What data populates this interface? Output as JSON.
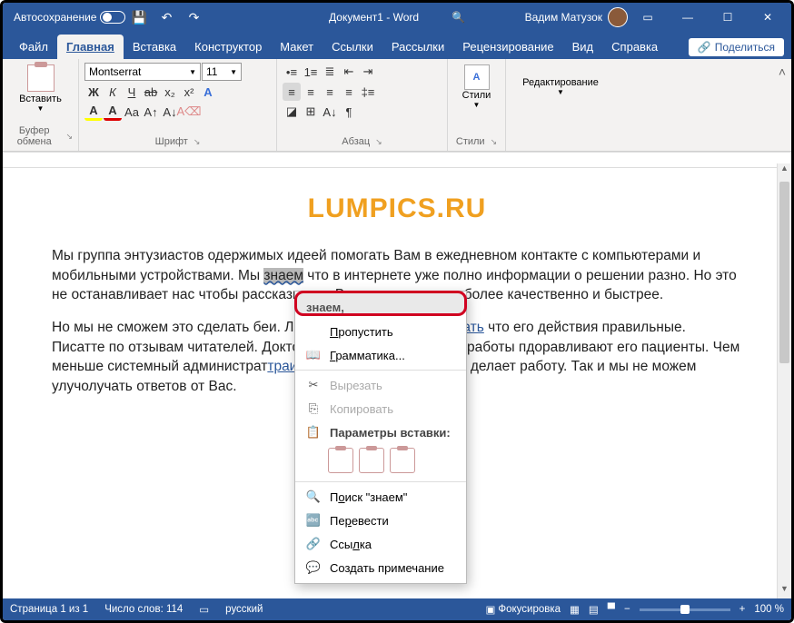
{
  "titlebar": {
    "autosave": "Автосохранение",
    "doc": "Документ1 - Word",
    "user": "Вадим Матузок"
  },
  "tabs": {
    "file": "Файл",
    "home": "Главная",
    "insert": "Вставка",
    "design": "Конструктор",
    "layout": "Макет",
    "references": "Ссылки",
    "mailings": "Рассылки",
    "review": "Рецензирование",
    "view": "Вид",
    "help": "Справка",
    "share": "Поделиться"
  },
  "ribbon": {
    "clipboard": {
      "paste": "Вставить",
      "label": "Буфер обмена"
    },
    "font": {
      "name": "Montserrat",
      "size": "11",
      "label": "Шрифт"
    },
    "para": {
      "label": "Абзац"
    },
    "styles": {
      "btn": "Стили",
      "label": "Стили"
    },
    "editing": {
      "btn": "Редактирование"
    }
  },
  "doc": {
    "title": "LUMPICS.RU",
    "p1a": "Мы группа энтузиастов одержимых идеей помогать Вам в ежедневном контакте с компьютерами и мобильными устройствами. Мы ",
    "p1b": "знаем",
    "p1c": " что в интернете уже полно информации о решении разно",
    "p1d": ". Но это не останавливает нас чтобы рассказывать Вам как решать м",
    "p1e": "и более качественно и быстрее.",
    "p2a": "Но мы не сможем это сделать бе",
    "p2b": "и. Любому человеку важно ",
    "p2c": "знать",
    "p2d": " что его действия правильные. Писат",
    "p2e": "те по отзывам читателей. Доктор судит о качестве своей работы п",
    "p2f": "доравливают его пациенты. Чем меньше системный администрат",
    "p2g": "траивает",
    "p2h": " тем он качественнее делает работу. Так и мы не можем улуч",
    "p2i": "олучать ответов от Вас."
  },
  "context": {
    "suggest": "знаем,",
    "skip": "Пропустить",
    "grammar": "Грамматика...",
    "cut": "Вырезать",
    "copy": "Копировать",
    "paste_opts": "Параметры вставки:",
    "search": "Поиск \"знаем\"",
    "translate": "Перевести",
    "link": "Ссылка",
    "comment": "Создать примечание"
  },
  "status": {
    "page": "Страница 1 из 1",
    "words": "Число слов: 114",
    "lang": "русский",
    "focus": "Фокусировка",
    "zoom": "100 %"
  }
}
